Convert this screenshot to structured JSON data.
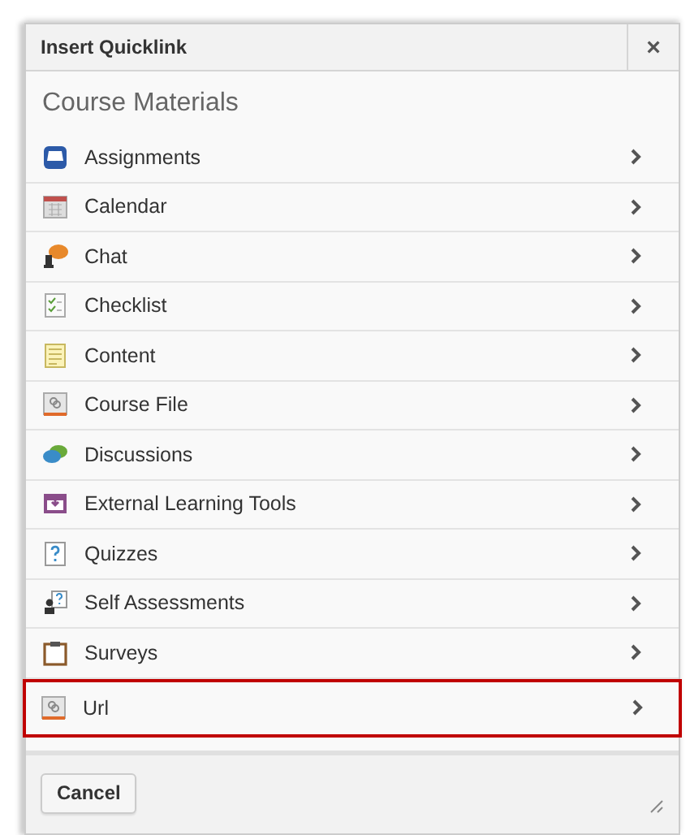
{
  "dialog": {
    "title": "Insert Quicklink",
    "close": "×"
  },
  "section_title": "Course Materials",
  "items": [
    {
      "label": "Assignments",
      "selected": false
    },
    {
      "label": "Calendar",
      "selected": false
    },
    {
      "label": "Chat",
      "selected": false
    },
    {
      "label": "Checklist",
      "selected": false
    },
    {
      "label": "Content",
      "selected": false
    },
    {
      "label": "Course File",
      "selected": false
    },
    {
      "label": "Discussions",
      "selected": false
    },
    {
      "label": "External Learning Tools",
      "selected": false
    },
    {
      "label": "Quizzes",
      "selected": false
    },
    {
      "label": "Self Assessments",
      "selected": false
    },
    {
      "label": "Surveys",
      "selected": false
    },
    {
      "label": "Url",
      "selected": true
    }
  ],
  "buttons": [
    "Cancel"
  ]
}
